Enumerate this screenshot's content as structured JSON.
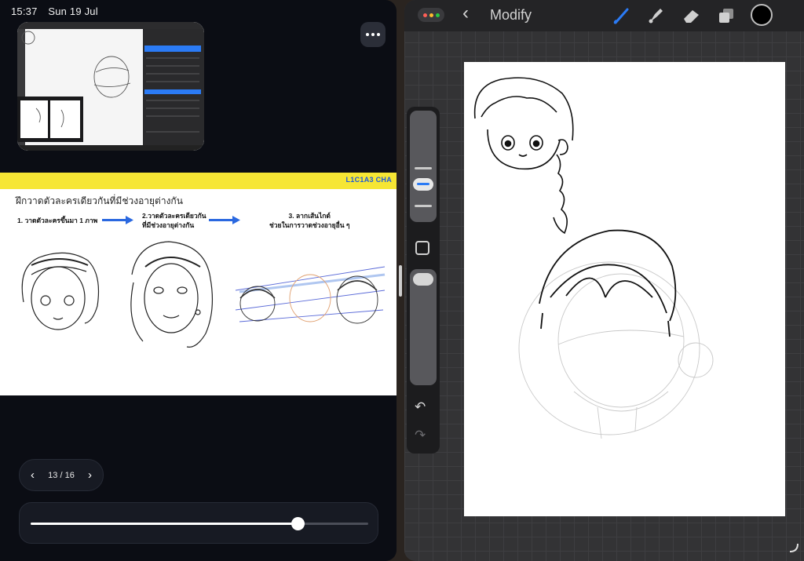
{
  "status_bar": {
    "time": "15:37",
    "date": "Sun 19 Jul"
  },
  "slide_viewer": {
    "band_code": "L1C1A3 CHA",
    "headline": "ฝึกวาดตัวละครเดียวกันที่มีช่วงอายุต่างกัน",
    "steps": [
      {
        "line1": "1. วาดตัวละครขึ้นมา 1 ภาพ",
        "line2": ""
      },
      {
        "line1": "2.วาดตัวละครเดียวกัน",
        "line2": "ที่มีช่วงอายุต่างกัน"
      },
      {
        "line1": "3. ลากเส้นไกด์",
        "line2": "ช่วยในการวาดช่วงอายุอื่น ๆ"
      }
    ],
    "page_label": "13 / 16",
    "progress": 0.79
  },
  "drawing_app": {
    "title": "Modify",
    "accent_color": "#2b7bf5",
    "current_color": "#000000",
    "tools": [
      "brush-icon",
      "smudge-icon",
      "eraser-icon",
      "layers-icon"
    ]
  }
}
